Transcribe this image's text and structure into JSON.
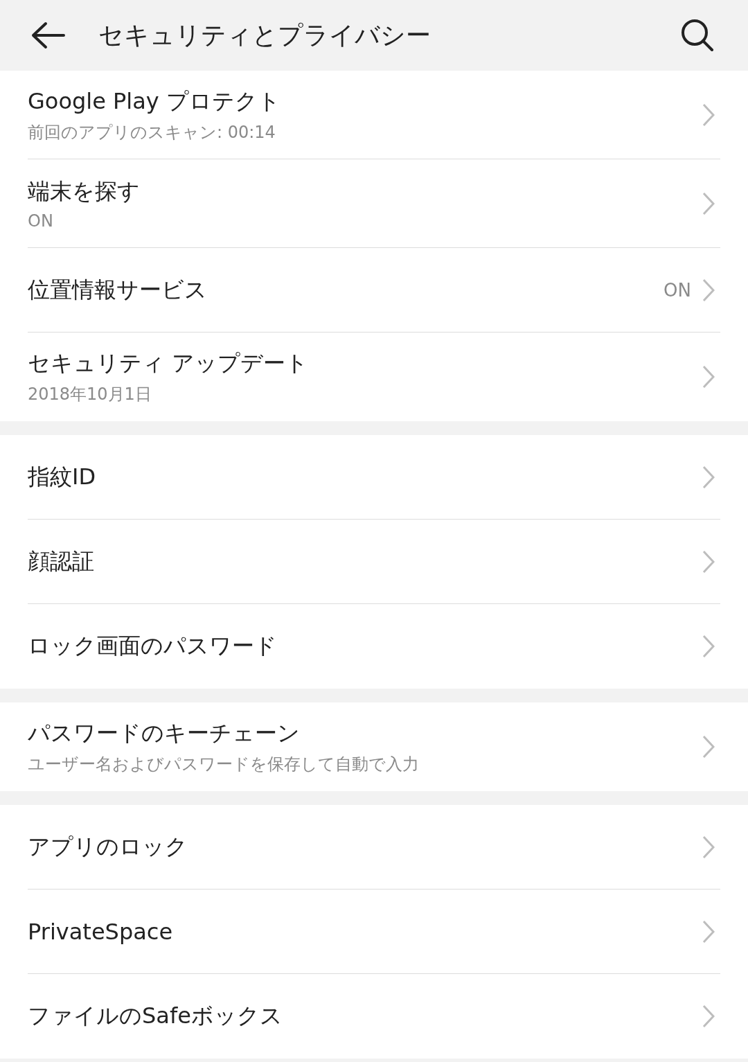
{
  "header": {
    "title": "セキュリティとプライバシー"
  },
  "groups": [
    {
      "items": [
        {
          "title": "Google Play プロテクト",
          "subtitle": "前回のアプリのスキャン: 00:14"
        },
        {
          "title": "端末を探す",
          "subtitle": "ON"
        },
        {
          "title": "位置情報サービス",
          "value": "ON"
        },
        {
          "title": "セキュリティ アップデート",
          "subtitle": "2018年10月1日"
        }
      ]
    },
    {
      "items": [
        {
          "title": "指紋ID"
        },
        {
          "title": "顔認証"
        },
        {
          "title": "ロック画面のパスワード"
        }
      ]
    },
    {
      "items": [
        {
          "title": "パスワードのキーチェーン",
          "subtitle": "ユーザー名およびパスワードを保存して自動で入力"
        }
      ]
    },
    {
      "items": [
        {
          "title": "アプリのロック"
        },
        {
          "title": "PrivateSpace"
        },
        {
          "title": "ファイルのSafeボックス"
        }
      ]
    }
  ]
}
